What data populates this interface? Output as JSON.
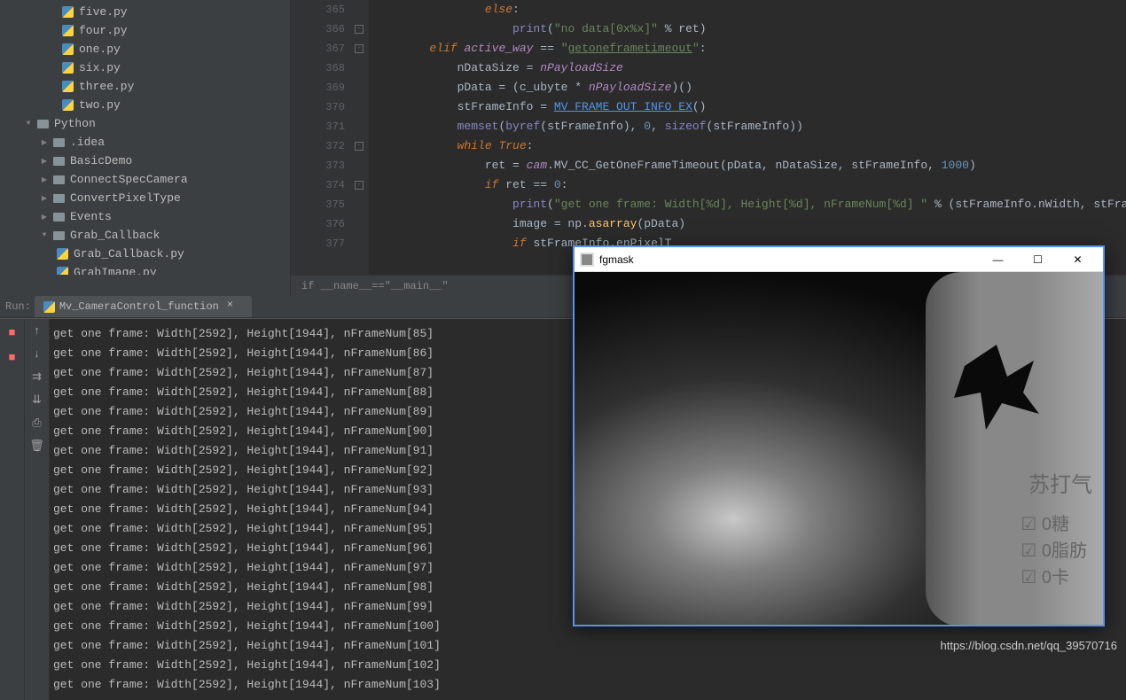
{
  "sidebar": {
    "files": [
      {
        "label": "five.py",
        "type": "py",
        "indent": 68
      },
      {
        "label": "four.py",
        "type": "py",
        "indent": 68
      },
      {
        "label": "one.py",
        "type": "py",
        "indent": 68
      },
      {
        "label": "six.py",
        "type": "py",
        "indent": 68
      },
      {
        "label": "three.py",
        "type": "py",
        "indent": 68
      },
      {
        "label": "two.py",
        "type": "py",
        "indent": 68
      }
    ],
    "folders": [
      {
        "label": "Python",
        "indent": 26,
        "chevron": "down"
      },
      {
        "label": ".idea",
        "indent": 44,
        "chevron": "right"
      },
      {
        "label": "BasicDemo",
        "indent": 44,
        "chevron": "right"
      },
      {
        "label": "ConnectSpecCamera",
        "indent": 44,
        "chevron": "right"
      },
      {
        "label": "ConvertPixelType",
        "indent": 44,
        "chevron": "right"
      },
      {
        "label": "Events",
        "indent": 44,
        "chevron": "right"
      },
      {
        "label": "Grab_Callback",
        "indent": 44,
        "chevron": "down"
      }
    ],
    "subfiles": [
      {
        "label": "Grab_Callback.py",
        "type": "py",
        "indent": 62
      },
      {
        "label": "GrabImage.py",
        "type": "py",
        "indent": 62
      }
    ]
  },
  "editor": {
    "lines": [
      {
        "num": "365",
        "html": "                <span class='kw'>else</span>:"
      },
      {
        "num": "366",
        "html": "                    <span class='builtin'>print</span>(<span class='str'>\"no data[0x%x]\"</span> % ret)"
      },
      {
        "num": "367",
        "html": "        <span class='kw'>elif</span> <span class='gvar'>active_way</span> == <span class='strw'>\"<u>getoneframetimeout</u>\"</span>:"
      },
      {
        "num": "368",
        "html": "            nDataSize = <span class='gvar'>nPayloadSize</span>"
      },
      {
        "num": "369",
        "html": "            pData = (c_ubyte * <span class='gvar'>nPayloadSize</span>)()"
      },
      {
        "num": "370",
        "html": "            stFrameInfo = <span class='und'>MV_FRAME_OUT_INFO_EX</span>()"
      },
      {
        "num": "371",
        "html": "            <span class='builtin'>memset</span>(<span class='builtin'>byref</span>(stFrameInfo), <span class='num'>0</span>, <span class='builtin'>sizeof</span>(stFrameInfo))"
      },
      {
        "num": "372",
        "html": "            <span class='kw'>while</span> <span class='kw'>True</span>:"
      },
      {
        "num": "373",
        "html": "                ret = <span class='gvar'>cam</span>.MV_CC_GetOneFrameTimeout(pData, nDataSize, stFrameInfo, <span class='num'>1000</span>)"
      },
      {
        "num": "374",
        "html": "                <span class='kw'>if</span> ret == <span class='num'>0</span>:"
      },
      {
        "num": "375",
        "html": "                    <span class='builtin'>print</span>(<span class='str'>\"get one frame: Width[%d], Height[%d], nFrameNum[%d] \"</span> % (stFrameInfo.nWidth, stFrameInfo.nHeight, stF"
      },
      {
        "num": "376",
        "html": "                    image = np.<span class='fn'>asarray</span>(pData)"
      },
      {
        "num": "377",
        "html": "                    <span class='kw'>if</span> stFrameInfo.enPixelT"
      }
    ],
    "fold_markers": [
      1,
      2,
      7,
      9
    ]
  },
  "breadcrumb": "if __name__==\"__main__\"",
  "run": {
    "tab_label": "Mv_CameraControl_function",
    "run_label": "Run:",
    "output": [
      "get one frame: Width[2592], Height[1944], nFrameNum[85]",
      "get one frame: Width[2592], Height[1944], nFrameNum[86]",
      "get one frame: Width[2592], Height[1944], nFrameNum[87]",
      "get one frame: Width[2592], Height[1944], nFrameNum[88]",
      "get one frame: Width[2592], Height[1944], nFrameNum[89]",
      "get one frame: Width[2592], Height[1944], nFrameNum[90]",
      "get one frame: Width[2592], Height[1944], nFrameNum[91]",
      "get one frame: Width[2592], Height[1944], nFrameNum[92]",
      "get one frame: Width[2592], Height[1944], nFrameNum[93]",
      "get one frame: Width[2592], Height[1944], nFrameNum[94]",
      "get one frame: Width[2592], Height[1944], nFrameNum[95]",
      "get one frame: Width[2592], Height[1944], nFrameNum[96]",
      "get one frame: Width[2592], Height[1944], nFrameNum[97]",
      "get one frame: Width[2592], Height[1944], nFrameNum[98]",
      "get one frame: Width[2592], Height[1944], nFrameNum[99]",
      "get one frame: Width[2592], Height[1944], nFrameNum[100]",
      "get one frame: Width[2592], Height[1944], nFrameNum[101]",
      "get one frame: Width[2592], Height[1944], nFrameNum[102]",
      "get one frame: Width[2592], Height[1944], nFrameNum[103]"
    ]
  },
  "popup": {
    "title": "fgmask",
    "bottle_heading": "苏打气",
    "checks": [
      "☑ 0糖",
      "☑ 0脂肪",
      "☑ 0卡"
    ]
  },
  "watermark": "https://blog.csdn.net/qq_39570716"
}
